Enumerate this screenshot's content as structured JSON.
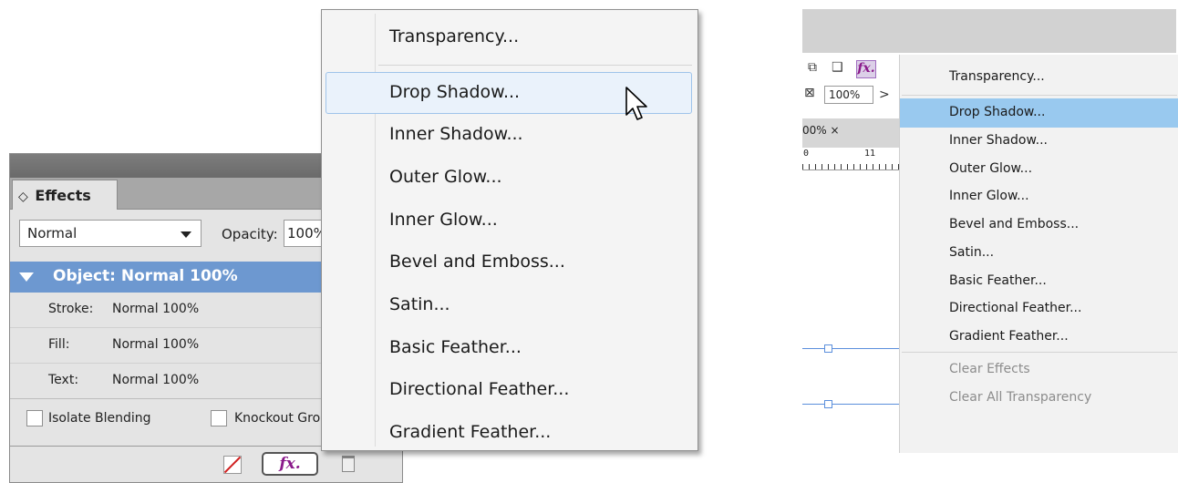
{
  "effects_panel": {
    "tab_label": "Effects",
    "tab_icon": "◇",
    "blend_mode": "Normal",
    "opacity_label": "Opacity:",
    "opacity_value": "100%",
    "object_row": "Object: Normal 100%",
    "rows": [
      {
        "key": "Stroke:",
        "value": "Normal 100%"
      },
      {
        "key": "Fill:",
        "value": "Normal 100%"
      },
      {
        "key": "Text:",
        "value": "Normal 100%"
      }
    ],
    "isolate_blending": "Isolate Blending",
    "knockout_group": "Knockout Group",
    "fx_button": "fx."
  },
  "menu_left": {
    "items": [
      "Transparency...",
      "Drop Shadow...",
      "Inner Shadow...",
      "Outer Glow...",
      "Inner Glow...",
      "Bevel and Emboss...",
      "Satin...",
      "Basic Feather...",
      "Directional Feather...",
      "Gradient Feather..."
    ],
    "highlighted": "Drop Shadow..."
  },
  "right_window": {
    "fx_label": "fx.",
    "zoom_value": "100%",
    "zoom_arrow": ">",
    "doc_tab_label": "00%  ×",
    "ruler_numbers": [
      "0",
      "11"
    ]
  },
  "menu_right": {
    "items": [
      "Transparency...",
      "Drop Shadow...",
      "Inner Shadow...",
      "Outer Glow...",
      "Inner Glow...",
      "Bevel and Emboss...",
      "Satin...",
      "Basic Feather...",
      "Directional Feather...",
      "Gradient Feather..."
    ],
    "disabled_items": [
      "Clear Effects",
      "Clear All Transparency"
    ],
    "highlighted": "Drop Shadow..."
  }
}
